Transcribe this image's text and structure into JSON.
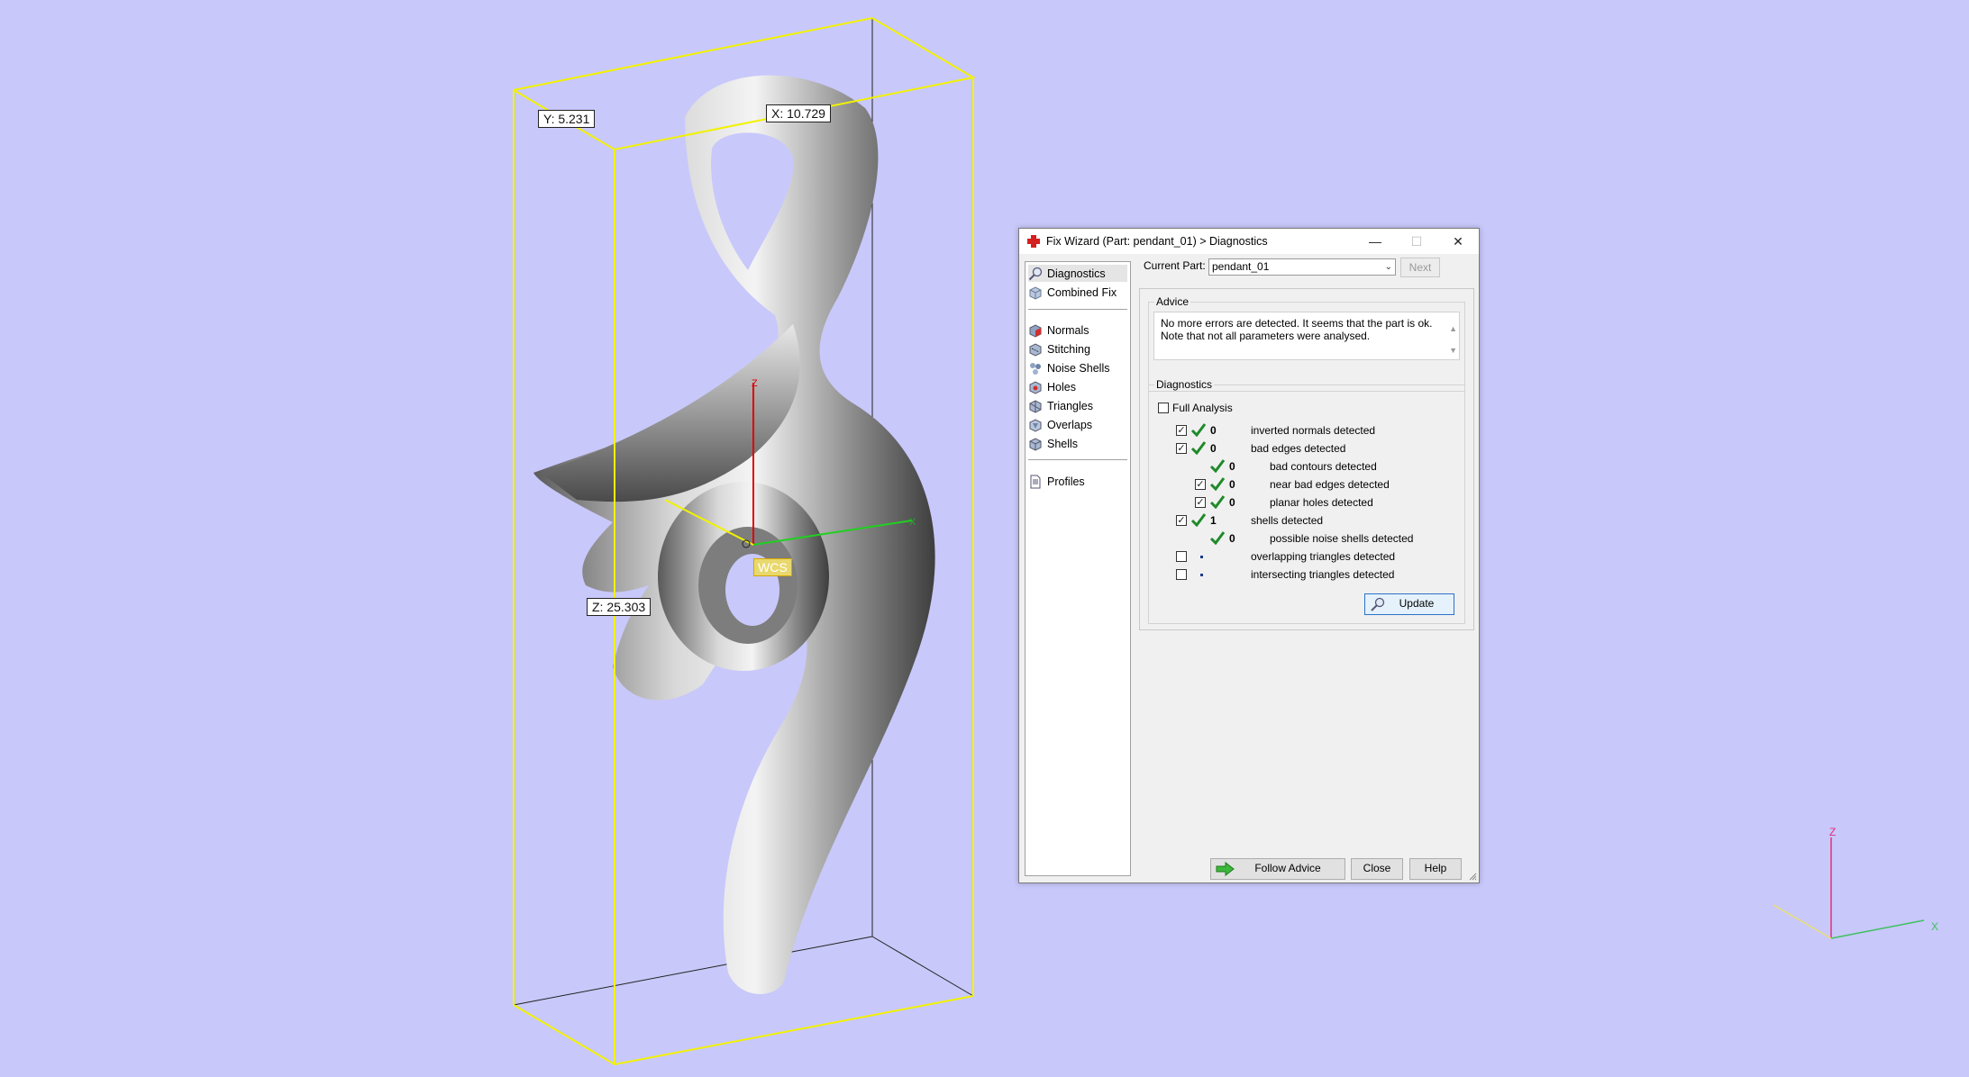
{
  "viewport": {
    "dim_y": "Y: 5.231",
    "dim_x": "X: 10.729",
    "dim_z": "Z: 25.303",
    "wcs_label": "WCS",
    "axis_x": "X",
    "axis_z": "Z",
    "mini_axis_x": "X",
    "mini_axis_z": "Z",
    "background_color": "#c8c8fb",
    "bbox_color": "#f2f200"
  },
  "dialog": {
    "title": "Fix Wizard (Part: pendant_01) > Diagnostics",
    "nav": {
      "items_top": [
        {
          "label": "Diagnostics",
          "icon": "magnifier-icon",
          "selected": true
        },
        {
          "label": "Combined Fix",
          "icon": "cube-fix-icon"
        }
      ],
      "items_mid": [
        {
          "label": "Normals",
          "icon": "normals-icon"
        },
        {
          "label": "Stitching",
          "icon": "stitching-icon"
        },
        {
          "label": "Noise Shells",
          "icon": "noise-shells-icon"
        },
        {
          "label": "Holes",
          "icon": "holes-icon"
        },
        {
          "label": "Triangles",
          "icon": "triangles-icon"
        },
        {
          "label": "Overlaps",
          "icon": "overlaps-icon"
        },
        {
          "label": "Shells",
          "icon": "shells-icon"
        }
      ],
      "items_bottom": [
        {
          "label": "Profiles",
          "icon": "document-icon"
        }
      ]
    },
    "current_part_label": "Current Part:",
    "current_part_value": "pendant_01",
    "next_label": "Next",
    "advice_title": "Advice",
    "advice_text": "No more errors are detected. It seems that the part is ok. Note that not all parameters were analysed.",
    "diagnostics_title": "Diagnostics",
    "full_analysis_label": "Full Analysis",
    "rows": [
      {
        "checked": true,
        "status": "ok",
        "count": "0",
        "label": "inverted normals detected",
        "indent": 0
      },
      {
        "checked": true,
        "status": "ok",
        "count": "0",
        "label": "bad edges detected",
        "indent": 0
      },
      {
        "checked": null,
        "status": "ok",
        "count": "0",
        "label": "bad contours detected",
        "indent": 1
      },
      {
        "checked": true,
        "status": "ok",
        "count": "0",
        "label": "near bad edges detected",
        "indent": 1
      },
      {
        "checked": true,
        "status": "ok",
        "count": "0",
        "label": "planar holes detected",
        "indent": 1
      },
      {
        "checked": true,
        "status": "ok",
        "count": "1",
        "label": "shells detected",
        "indent": 0
      },
      {
        "checked": null,
        "status": "ok",
        "count": "0",
        "label": "possible noise shells detected",
        "indent": 1
      },
      {
        "checked": false,
        "status": "none",
        "count": "",
        "label": "overlapping triangles detected",
        "indent": 0
      },
      {
        "checked": false,
        "status": "none",
        "count": "",
        "label": "intersecting triangles detected",
        "indent": 0
      }
    ],
    "update_label": "Update",
    "follow_advice_label": "Follow Advice",
    "close_label": "Close",
    "help_label": "Help"
  }
}
